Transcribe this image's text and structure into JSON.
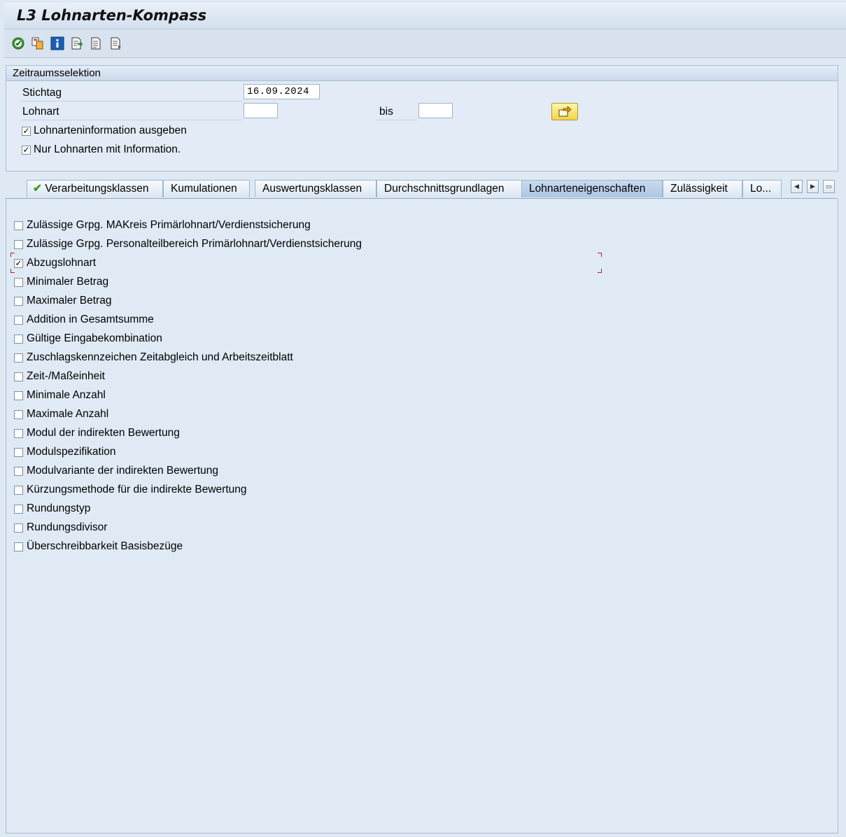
{
  "title": "L3 Lohnarten-Kompass",
  "toolbar": {
    "icons": [
      "execute-icon",
      "copy-icon",
      "information-icon",
      "export-icon",
      "document-icon",
      "document-alt-icon"
    ]
  },
  "selection": {
    "group_title": "Zeitraumsselektion",
    "stichtag_label": "Stichtag",
    "stichtag_value": "16.09.2024",
    "lohnart_label": "Lohnart",
    "lohnart_from": "",
    "bis_label": "bis",
    "lohnart_to": "",
    "options": [
      {
        "label": "Lohnarteninformation ausgeben",
        "checked": true
      },
      {
        "label": "Nur Lohnarten mit Information.",
        "checked": true
      }
    ]
  },
  "tabs": [
    {
      "label": "Verarbeitungsklassen",
      "checkmark": true
    },
    {
      "label": "Kumulationen"
    },
    {
      "label": "Auswertungsklassen"
    },
    {
      "label": "Durchschnittsgrundlagen"
    },
    {
      "label": "Lohnarteneigenschaften",
      "active": true
    },
    {
      "label": "Zulässigkeit"
    },
    {
      "label": "Lo..."
    }
  ],
  "properties": [
    {
      "label": "Zulässige Grpg. MAKreis Primärlohnart/Verdienstsicherung",
      "checked": false
    },
    {
      "label": "Zulässige Grpg. Personalteilbereich Primärlohnart/Verdienstsicherung",
      "checked": false
    },
    {
      "label": "Abzugslohnart",
      "checked": true
    },
    {
      "label": "Minimaler Betrag",
      "checked": false
    },
    {
      "label": "Maximaler Betrag",
      "checked": false
    },
    {
      "label": "Addition in Gesamtsumme",
      "checked": false
    },
    {
      "label": "Gültige Eingabekombination",
      "checked": false
    },
    {
      "label": "Zuschlagskennzeichen Zeitabgleich und Arbeitszeitblatt",
      "checked": false
    },
    {
      "label": "Zeit-/Maßeinheit",
      "checked": false
    },
    {
      "label": "Minimale Anzahl",
      "checked": false
    },
    {
      "label": "Maximale Anzahl",
      "checked": false
    },
    {
      "label": "Modul der indirekten Bewertung",
      "checked": false
    },
    {
      "label": "Modulspezifikation",
      "checked": false
    },
    {
      "label": "Modulvariante der indirekten Bewertung",
      "checked": false
    },
    {
      "label": "Kürzungsmethode für die indirekte Bewertung",
      "checked": false
    },
    {
      "label": "Rundungstyp",
      "checked": false
    },
    {
      "label": "Rundungsdivisor",
      "checked": false
    },
    {
      "label": "Überschreibbarkeit Basisbezüge",
      "checked": false
    }
  ]
}
